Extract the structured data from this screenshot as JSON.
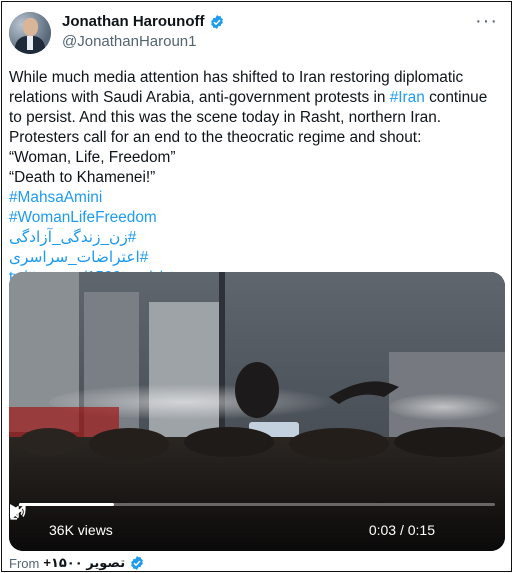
{
  "author": {
    "display_name": "Jonathan Harounoff",
    "handle": "@JonathanHaroun1"
  },
  "tweet": {
    "text_1": "While much media attention has shifted to Iran restoring diplomatic",
    "text_2": "relations with Saudi Arabia, anti-government protests in ",
    "hashtag_iran": "#Iran",
    "text_2b": " continue",
    "text_3": "to persist. And this was the scene today in Rasht, northern Iran.",
    "text_4": "Protesters call for an end to the theocratic regime and shout:",
    "text_5": "“Woman, Life, Freedom”",
    "text_6": "“Death to Khamenei!”",
    "hashtag_1": "#MahsaAmini",
    "hashtag_2": "#WomanLifeFreedom",
    "hashtag_3": "#زن_زندگی_آزادگی",
    "hashtag_4": "#اعتراضات_سراسری",
    "link": "twitter.com/1500tasvir/sta…"
  },
  "video": {
    "views": "36K views",
    "time": "0:03 / 0:15",
    "progress": 0.2
  },
  "attribution": {
    "from_label": "From",
    "source_name": "تصویر ۱۵۰۰+"
  },
  "colors": {
    "link": "#1d9bf0",
    "verified": "#1d9bf0",
    "text": "#0f1419",
    "muted": "#536471"
  },
  "icons": [
    "verified-badge-icon",
    "more-icon",
    "play-icon",
    "volume-icon",
    "fullscreen-icon"
  ]
}
